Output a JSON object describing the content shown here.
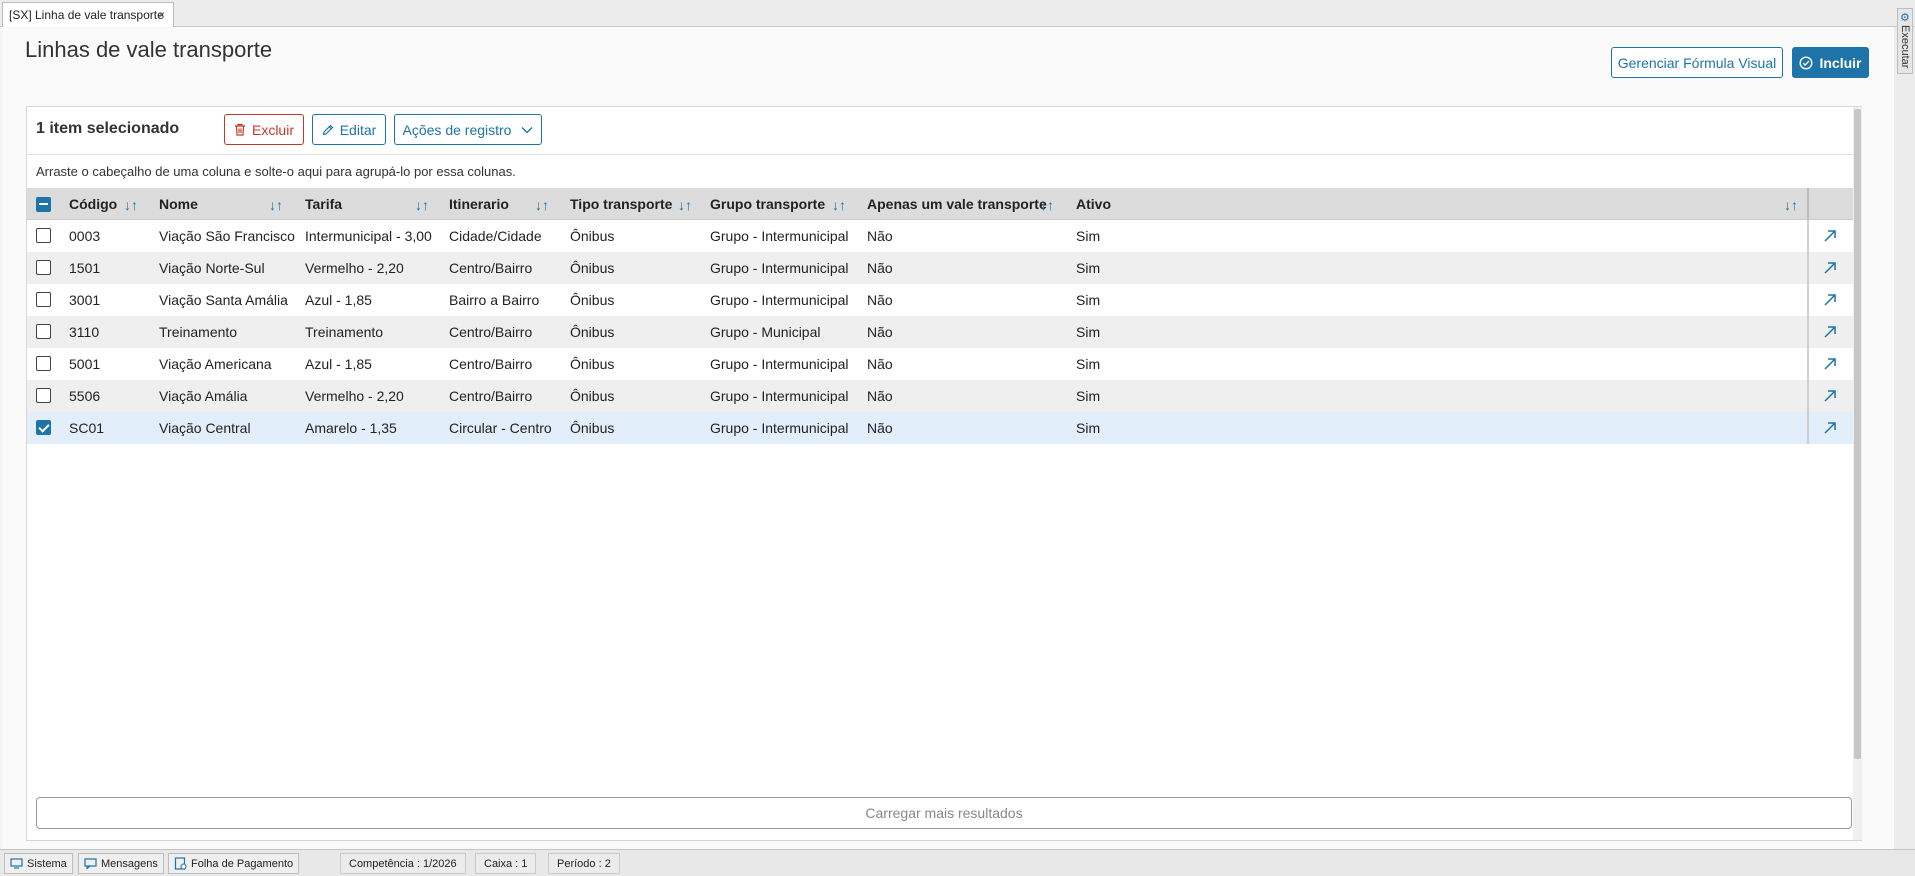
{
  "tab": {
    "title": "[SX] Linha de vale transporte",
    "close": "×"
  },
  "page": {
    "title": "Linhas de vale transporte"
  },
  "header_buttons": {
    "formula": "Gerenciar Fórmula Visual",
    "include": "Incluir"
  },
  "toolbar": {
    "selected_count": "1 item selecionado",
    "delete": "Excluir",
    "edit": "Editar",
    "record_actions": "Ações de registro"
  },
  "group_hint": "Arraste o cabeçalho de uma coluna e solte-o aqui para agrupá-lo por essa colunas.",
  "columns": [
    "Código",
    "Nome",
    "Tarifa",
    "Itinerario",
    "Tipo transporte",
    "Grupo transporte",
    "Apenas um vale transporte",
    "Ativo"
  ],
  "rows": [
    {
      "codigo": "0003",
      "nome": "Viação São Francisco",
      "tarifa": "Intermunicipal - 3,00",
      "itinerario": "Cidade/Cidade",
      "tipo": "Ônibus",
      "grupo": "Grupo - Intermunicipal",
      "apenas": "Não",
      "ativo": "Sim",
      "selected": false
    },
    {
      "codigo": "1501",
      "nome": "Viação Norte-Sul",
      "tarifa": "Vermelho - 2,20",
      "itinerario": "Centro/Bairro",
      "tipo": "Ônibus",
      "grupo": "Grupo - Intermunicipal",
      "apenas": "Não",
      "ativo": "Sim",
      "selected": false
    },
    {
      "codigo": "3001",
      "nome": "Viação Santa Amália",
      "tarifa": "Azul - 1,85",
      "itinerario": "Bairro a Bairro",
      "tipo": "Ônibus",
      "grupo": "Grupo - Intermunicipal",
      "apenas": "Não",
      "ativo": "Sim",
      "selected": false
    },
    {
      "codigo": "3110",
      "nome": "Treinamento",
      "tarifa": "Treinamento",
      "itinerario": "Centro/Bairro",
      "tipo": "Ônibus",
      "grupo": "Grupo - Municipal",
      "apenas": "Não",
      "ativo": "Sim",
      "selected": false
    },
    {
      "codigo": "5001",
      "nome": "Viação Americana",
      "tarifa": "Azul - 1,85",
      "itinerario": "Centro/Bairro",
      "tipo": "Ônibus",
      "grupo": "Grupo - Intermunicipal",
      "apenas": "Não",
      "ativo": "Sim",
      "selected": false
    },
    {
      "codigo": "5506",
      "nome": "Viação Amália",
      "tarifa": "Vermelho - 2,20",
      "itinerario": "Centro/Bairro",
      "tipo": "Ônibus",
      "grupo": "Grupo - Intermunicipal",
      "apenas": "Não",
      "ativo": "Sim",
      "selected": false
    },
    {
      "codigo": "SC01",
      "nome": "Viação Central",
      "tarifa": "Amarelo - 1,35",
      "itinerario": "Circular - Centro",
      "tipo": "Ônibus",
      "grupo": "Grupo - Intermunicipal",
      "apenas": "Não",
      "ativo": "Sim",
      "selected": true
    }
  ],
  "load_more": "Carregar mais resultados",
  "side_tab": {
    "label": "Executar"
  },
  "statusbar": {
    "sistema": "Sistema",
    "mensagens": "Mensagens",
    "folha": "Folha de Pagamento",
    "competencia": "Competência : 1/2026",
    "caixa": "Caixa : 1",
    "periodo": "Período : 2"
  },
  "colors": {
    "accent": "#1e73a8",
    "danger": "#c0392b",
    "selected_row": "#e3eefb",
    "annotation": "#e02020"
  }
}
